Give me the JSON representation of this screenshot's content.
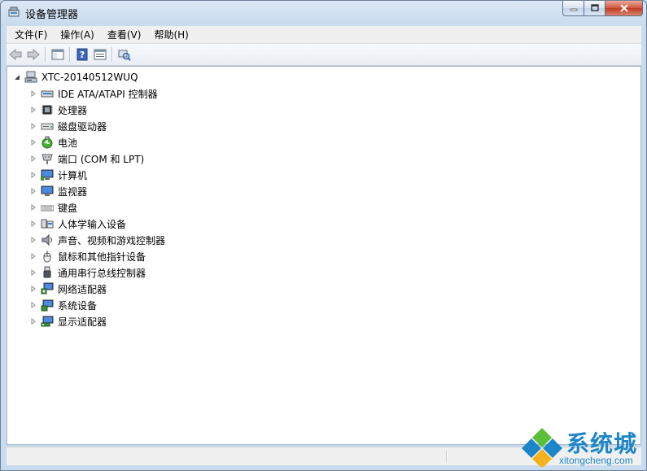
{
  "window": {
    "title": "设备管理器",
    "controls": {
      "minimize_icon": "minimize-icon",
      "maximize_icon": "maximize-icon",
      "close_icon": "close-icon"
    }
  },
  "menu": [
    {
      "label": "文件(F)"
    },
    {
      "label": "操作(A)"
    },
    {
      "label": "查看(V)"
    },
    {
      "label": "帮助(H)"
    }
  ],
  "toolbar": {
    "icons": [
      "back-arrow-icon",
      "forward-arrow-icon",
      "show-hide-console-tree-icon",
      "help-icon",
      "properties-icon",
      "scan-hardware-icon"
    ]
  },
  "tree": {
    "root": {
      "label": "XTC-20140512WUQ",
      "icon": "computer-icon"
    },
    "categories": [
      {
        "label": "IDE ATA/ATAPI 控制器",
        "icon": "ide-controller-icon"
      },
      {
        "label": "处理器",
        "icon": "processor-icon"
      },
      {
        "label": "磁盘驱动器",
        "icon": "disk-drive-icon"
      },
      {
        "label": "电池",
        "icon": "battery-icon"
      },
      {
        "label": "端口 (COM 和 LPT)",
        "icon": "port-icon"
      },
      {
        "label": "计算机",
        "icon": "computer-monitor-icon"
      },
      {
        "label": "监视器",
        "icon": "monitor-icon"
      },
      {
        "label": "键盘",
        "icon": "keyboard-icon"
      },
      {
        "label": "人体学输入设备",
        "icon": "hid-icon"
      },
      {
        "label": "声音、视频和游戏控制器",
        "icon": "speaker-icon"
      },
      {
        "label": "鼠标和其他指针设备",
        "icon": "mouse-icon"
      },
      {
        "label": "通用串行总线控制器",
        "icon": "usb-icon"
      },
      {
        "label": "网络适配器",
        "icon": "network-adapter-icon"
      },
      {
        "label": "系统设备",
        "icon": "system-device-icon"
      },
      {
        "label": "显示适配器",
        "icon": "display-adapter-icon"
      }
    ]
  },
  "watermark": {
    "text_cn": "系统城",
    "text_en": "xitongcheng.com",
    "color": "#1d86c8"
  },
  "colors": {
    "frame": "#c9dbee",
    "close_button": "#c8462c",
    "tree_bg": "#ffffff"
  }
}
